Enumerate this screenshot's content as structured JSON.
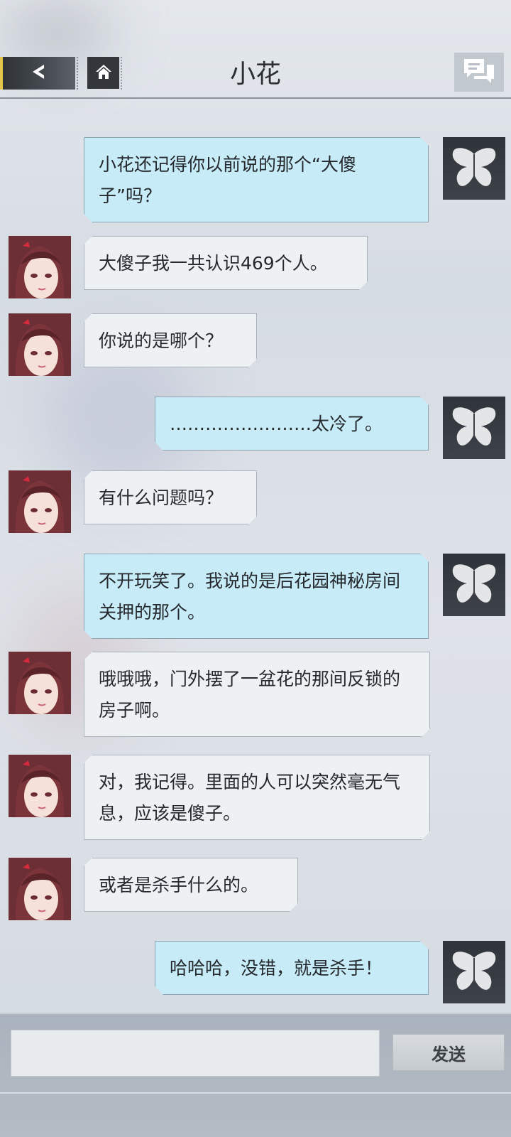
{
  "header": {
    "title": "小花",
    "back_icon": "back-arrow-icon",
    "home_icon": "home-icon",
    "chat_list_icon": "chat-bubbles-icon"
  },
  "messages": [
    {
      "sender": "self",
      "text": "小花还记得你以前说的那个“大傻子”吗？"
    },
    {
      "sender": "contact",
      "text": "大傻子我一共认识469个人。"
    },
    {
      "sender": "contact",
      "text": "你说的是哪个？"
    },
    {
      "sender": "self",
      "text": "……………………太冷了。"
    },
    {
      "sender": "contact",
      "text": "有什么问题吗？"
    },
    {
      "sender": "self",
      "text": "不开玩笑了。我说的是后花园神秘房间关押的那个。"
    },
    {
      "sender": "contact",
      "text": "哦哦哦，门外摆了一盆花的那间反锁的房子啊。"
    },
    {
      "sender": "contact",
      "text": "对，我记得。里面的人可以突然毫无气息，应该是傻子。"
    },
    {
      "sender": "contact",
      "text": "或者是杀手什么的。"
    },
    {
      "sender": "self",
      "text": "哈哈哈，没错，就是杀手！"
    }
  ],
  "input": {
    "value": "",
    "placeholder": ""
  },
  "send_button": {
    "label": "发送"
  },
  "colors": {
    "outgoing_bubble": "#c7ecf8",
    "incoming_bubble": "#eef1f4",
    "back_accent": "#e6c34a"
  }
}
